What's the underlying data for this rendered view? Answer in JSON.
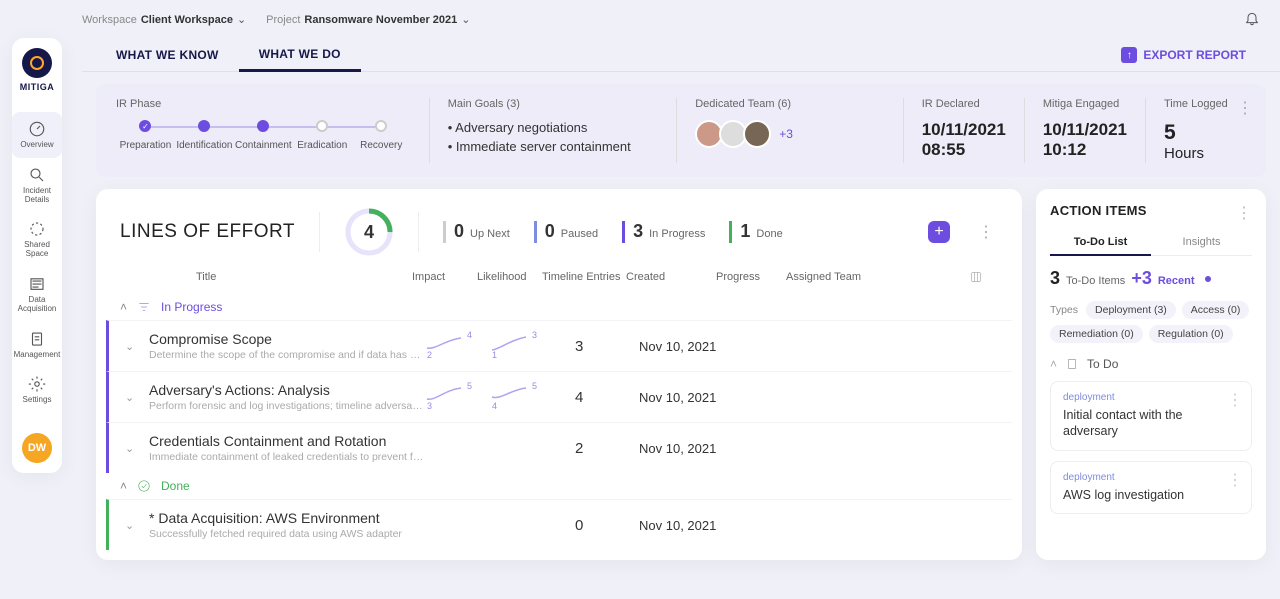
{
  "brand": "MITIGA",
  "sidebar": {
    "items": [
      {
        "label": "Overview"
      },
      {
        "label": "Incident Details"
      },
      {
        "label": "Shared Space"
      },
      {
        "label": "Data Acquisition"
      },
      {
        "label": "Management"
      }
    ],
    "settings": "Settings",
    "user_initials": "DW"
  },
  "breadcrumb": {
    "workspace_label": "Workspace",
    "workspace_value": "Client Workspace",
    "project_label": "Project",
    "project_value": "Ransomware November 2021"
  },
  "tabs": {
    "know": "WHAT WE KNOW",
    "do": "WHAT WE DO"
  },
  "export_label": "EXPORT REPORT",
  "summary": {
    "phase_title": "IR Phase",
    "phases": [
      "Preparation",
      "Identification",
      "Containment",
      "Eradication",
      "Recovery"
    ],
    "goals_title": "Main Goals (3)",
    "goals": [
      "Adversary negotiations",
      "Immediate server containment"
    ],
    "team_title": "Dedicated Team (6)",
    "team_more": "+3",
    "declared_title": "IR Declared",
    "declared_date": "10/11/2021",
    "declared_time": "08:55",
    "engaged_title": "Mitiga Engaged",
    "engaged_date": "10/11/2021",
    "engaged_time": "10:12",
    "logged_title": "Time Logged",
    "logged_num": "5",
    "logged_unit": "Hours"
  },
  "lines": {
    "title": "LINES OF EFFORT",
    "total": "4",
    "stats": {
      "upnext_n": "0",
      "upnext_l": "Up Next",
      "paused_n": "0",
      "paused_l": "Paused",
      "inprogress_n": "3",
      "inprogress_l": "In Progress",
      "done_n": "1",
      "done_l": "Done"
    },
    "columns": {
      "title": "Title",
      "impact": "Impact",
      "like": "Likelihood",
      "timeline": "Timeline Entries",
      "created": "Created",
      "progress": "Progress",
      "team": "Assigned Team"
    },
    "sections": {
      "inprogress": "In Progress",
      "done": "Done"
    },
    "rows": {
      "r1_title": "Compromise Scope",
      "r1_desc": "Determine the scope of the compromise and if data has be...",
      "r1_impact_a": "2",
      "r1_impact_b": "4",
      "r1_like_a": "1",
      "r1_like_b": "3",
      "r1_tl": "3",
      "r1_date": "Nov 10, 2021",
      "r2_title": "Adversary's Actions: Analysis",
      "r2_desc": "Perform forensic and log investigations; timeline adversary...",
      "r2_impact_a": "3",
      "r2_impact_b": "5",
      "r2_like_a": "4",
      "r2_like_b": "5",
      "r2_tl": "4",
      "r2_date": "Nov 10, 2021",
      "r3_title": "Credentials Containment and Rotation",
      "r3_desc": "Immediate containment of leaked credentials to prevent fu...",
      "r3_tl": "2",
      "r3_date": "Nov 10, 2021",
      "r4_title": "* Data Acquisition: AWS Environment",
      "r4_desc": "Successfully fetched required data using AWS adapter",
      "r4_tl": "0",
      "r4_date": "Nov 10, 2021"
    }
  },
  "action": {
    "title": "ACTION ITEMS",
    "tab_todo": "To-Do List",
    "tab_insights": "Insights",
    "count_n": "3",
    "count_l": "To-Do Items",
    "recent_n": "+3",
    "recent_l": "Recent",
    "types_label": "Types",
    "chips": {
      "deployment": "Deployment (3)",
      "access": "Access (0)",
      "remediation": "Remediation (0)",
      "regulation": "Regulation (0)"
    },
    "section_todo": "To Do",
    "card1_tag": "deployment",
    "card1_text": "Initial contact with the adversary",
    "card2_tag": "deployment",
    "card2_text": "AWS log investigation"
  }
}
